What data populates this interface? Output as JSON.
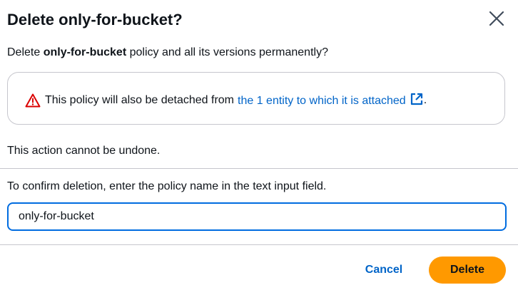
{
  "dialog": {
    "title": "Delete only-for-bucket?",
    "close_icon": "close-icon"
  },
  "prompt": {
    "before": "Delete ",
    "policy_name": "only-for-bucket",
    "after": " policy and all its versions permanently?"
  },
  "alert": {
    "icon": "warning-triangle-icon",
    "text": "This policy will also be detached from",
    "link_text": "the 1 entity to which it is attached",
    "link_icon": "external-link-icon",
    "trailing": ".",
    "warning_color": "#db0000",
    "link_color": "#0064c8"
  },
  "undone_text": "This action cannot be undone.",
  "confirm": {
    "label": "To confirm deletion, enter the policy name in the text input field.",
    "input_value": "only-for-bucket"
  },
  "footer": {
    "cancel_label": "Cancel",
    "delete_label": "Delete",
    "delete_color": "#ff9900"
  }
}
